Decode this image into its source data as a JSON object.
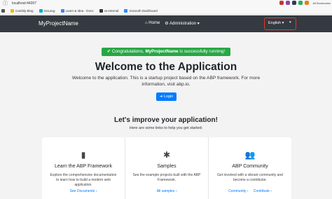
{
  "browser": {
    "url": "localhost:44307",
    "all_bookmarks": "All Bookmarks",
    "bookmarks": [
      {
        "label": "",
        "color": "#555555"
      },
      {
        "label": "Cambly Blog",
        "color": "#f0b90b"
      },
      {
        "label": "GoLang",
        "color": "#00add8"
      },
      {
        "label": "Learn & Idea - Docs",
        "color": "#4285f4"
      },
      {
        "label": "vs-internal",
        "color": "#333333"
      },
      {
        "label": "Voiceoth Dashboard",
        "color": "#2d8cff"
      }
    ]
  },
  "navbar": {
    "brand": "MyProjectName",
    "home": "⌂ Home",
    "admin": "⚙ Administration ▾",
    "language": "English ▾",
    "user_caret": "▾"
  },
  "hero": {
    "alert_prefix": "✔ Congratulations, ",
    "alert_project": "MyProjectName",
    "alert_suffix": " is successfully running!",
    "title": "Welcome to the Application",
    "lead": "Welcome to the application. This is a startup project based on the ABP framework. For more information, visit abp.io.",
    "login_button": "➜ Login"
  },
  "improve": {
    "title": "Let's improve your application!",
    "subtitle": "Here are some links to help you get started:"
  },
  "cards": [
    {
      "icon": "▮",
      "title": "Learn the ABP Framework",
      "desc": "Explore the comprehensive documentation to learn how to build a modern web application.",
      "links": [
        "See Documents ›"
      ]
    },
    {
      "icon": "✱",
      "title": "Samples",
      "desc": "See the example projects built with the ABP Framework.",
      "links": [
        "All samples ›"
      ]
    },
    {
      "icon": "👥",
      "title": "ABP Community",
      "desc": "Get involved with a vibrant community and become a contributor.",
      "links": [
        "Community ›",
        "Contribute ›"
      ]
    }
  ]
}
